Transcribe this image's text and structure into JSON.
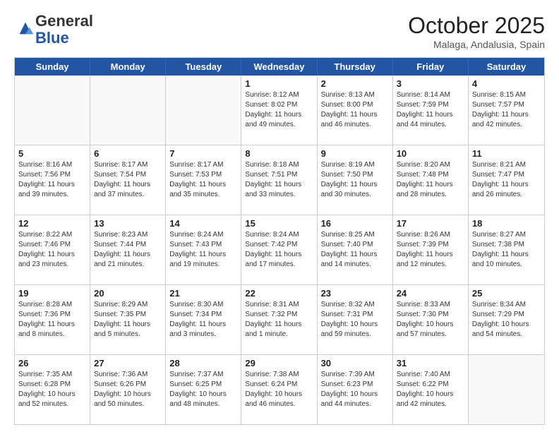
{
  "logo": {
    "general": "General",
    "blue": "Blue"
  },
  "title": "October 2025",
  "subtitle": "Malaga, Andalusia, Spain",
  "headers": [
    "Sunday",
    "Monday",
    "Tuesday",
    "Wednesday",
    "Thursday",
    "Friday",
    "Saturday"
  ],
  "rows": [
    [
      {
        "day": "",
        "info": ""
      },
      {
        "day": "",
        "info": ""
      },
      {
        "day": "",
        "info": ""
      },
      {
        "day": "1",
        "info": "Sunrise: 8:12 AM\nSunset: 8:02 PM\nDaylight: 11 hours\nand 49 minutes."
      },
      {
        "day": "2",
        "info": "Sunrise: 8:13 AM\nSunset: 8:00 PM\nDaylight: 11 hours\nand 46 minutes."
      },
      {
        "day": "3",
        "info": "Sunrise: 8:14 AM\nSunset: 7:59 PM\nDaylight: 11 hours\nand 44 minutes."
      },
      {
        "day": "4",
        "info": "Sunrise: 8:15 AM\nSunset: 7:57 PM\nDaylight: 11 hours\nand 42 minutes."
      }
    ],
    [
      {
        "day": "5",
        "info": "Sunrise: 8:16 AM\nSunset: 7:56 PM\nDaylight: 11 hours\nand 39 minutes."
      },
      {
        "day": "6",
        "info": "Sunrise: 8:17 AM\nSunset: 7:54 PM\nDaylight: 11 hours\nand 37 minutes."
      },
      {
        "day": "7",
        "info": "Sunrise: 8:17 AM\nSunset: 7:53 PM\nDaylight: 11 hours\nand 35 minutes."
      },
      {
        "day": "8",
        "info": "Sunrise: 8:18 AM\nSunset: 7:51 PM\nDaylight: 11 hours\nand 33 minutes."
      },
      {
        "day": "9",
        "info": "Sunrise: 8:19 AM\nSunset: 7:50 PM\nDaylight: 11 hours\nand 30 minutes."
      },
      {
        "day": "10",
        "info": "Sunrise: 8:20 AM\nSunset: 7:48 PM\nDaylight: 11 hours\nand 28 minutes."
      },
      {
        "day": "11",
        "info": "Sunrise: 8:21 AM\nSunset: 7:47 PM\nDaylight: 11 hours\nand 26 minutes."
      }
    ],
    [
      {
        "day": "12",
        "info": "Sunrise: 8:22 AM\nSunset: 7:46 PM\nDaylight: 11 hours\nand 23 minutes."
      },
      {
        "day": "13",
        "info": "Sunrise: 8:23 AM\nSunset: 7:44 PM\nDaylight: 11 hours\nand 21 minutes."
      },
      {
        "day": "14",
        "info": "Sunrise: 8:24 AM\nSunset: 7:43 PM\nDaylight: 11 hours\nand 19 minutes."
      },
      {
        "day": "15",
        "info": "Sunrise: 8:24 AM\nSunset: 7:42 PM\nDaylight: 11 hours\nand 17 minutes."
      },
      {
        "day": "16",
        "info": "Sunrise: 8:25 AM\nSunset: 7:40 PM\nDaylight: 11 hours\nand 14 minutes."
      },
      {
        "day": "17",
        "info": "Sunrise: 8:26 AM\nSunset: 7:39 PM\nDaylight: 11 hours\nand 12 minutes."
      },
      {
        "day": "18",
        "info": "Sunrise: 8:27 AM\nSunset: 7:38 PM\nDaylight: 11 hours\nand 10 minutes."
      }
    ],
    [
      {
        "day": "19",
        "info": "Sunrise: 8:28 AM\nSunset: 7:36 PM\nDaylight: 11 hours\nand 8 minutes."
      },
      {
        "day": "20",
        "info": "Sunrise: 8:29 AM\nSunset: 7:35 PM\nDaylight: 11 hours\nand 5 minutes."
      },
      {
        "day": "21",
        "info": "Sunrise: 8:30 AM\nSunset: 7:34 PM\nDaylight: 11 hours\nand 3 minutes."
      },
      {
        "day": "22",
        "info": "Sunrise: 8:31 AM\nSunset: 7:32 PM\nDaylight: 11 hours\nand 1 minute."
      },
      {
        "day": "23",
        "info": "Sunrise: 8:32 AM\nSunset: 7:31 PM\nDaylight: 10 hours\nand 59 minutes."
      },
      {
        "day": "24",
        "info": "Sunrise: 8:33 AM\nSunset: 7:30 PM\nDaylight: 10 hours\nand 57 minutes."
      },
      {
        "day": "25",
        "info": "Sunrise: 8:34 AM\nSunset: 7:29 PM\nDaylight: 10 hours\nand 54 minutes."
      }
    ],
    [
      {
        "day": "26",
        "info": "Sunrise: 7:35 AM\nSunset: 6:28 PM\nDaylight: 10 hours\nand 52 minutes."
      },
      {
        "day": "27",
        "info": "Sunrise: 7:36 AM\nSunset: 6:26 PM\nDaylight: 10 hours\nand 50 minutes."
      },
      {
        "day": "28",
        "info": "Sunrise: 7:37 AM\nSunset: 6:25 PM\nDaylight: 10 hours\nand 48 minutes."
      },
      {
        "day": "29",
        "info": "Sunrise: 7:38 AM\nSunset: 6:24 PM\nDaylight: 10 hours\nand 46 minutes."
      },
      {
        "day": "30",
        "info": "Sunrise: 7:39 AM\nSunset: 6:23 PM\nDaylight: 10 hours\nand 44 minutes."
      },
      {
        "day": "31",
        "info": "Sunrise: 7:40 AM\nSunset: 6:22 PM\nDaylight: 10 hours\nand 42 minutes."
      },
      {
        "day": "",
        "info": ""
      }
    ]
  ]
}
